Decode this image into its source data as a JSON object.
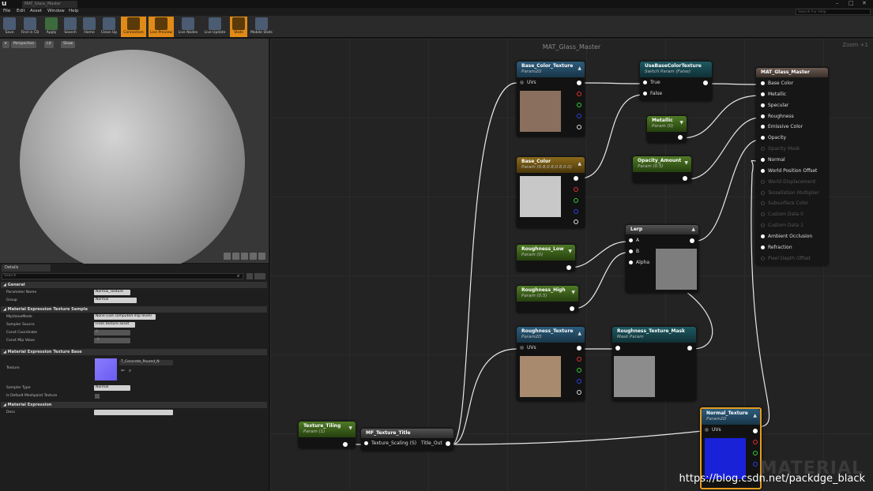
{
  "window": {
    "tab": "MAT_Glass_Master",
    "help_search_placeholder": "Search For Help",
    "controls": [
      "–",
      "□",
      "✕"
    ]
  },
  "menu": [
    "File",
    "Edit",
    "Asset",
    "Window",
    "Help"
  ],
  "toolbar": [
    {
      "label": "Save",
      "icon": "save-icon",
      "active": false
    },
    {
      "label": "Find in CB",
      "icon": "search-icon",
      "active": false
    },
    {
      "label": "Apply",
      "icon": "check-icon",
      "active": false
    },
    {
      "label": "Search",
      "icon": "binoculars-icon",
      "active": false
    },
    {
      "label": "Home",
      "icon": "home-icon",
      "active": false
    },
    {
      "label": "Clean Up",
      "icon": "broom-icon",
      "active": false
    },
    {
      "label": "Connectors",
      "icon": "connectors-icon",
      "active": true
    },
    {
      "label": "Live Preview",
      "icon": "live-preview-icon",
      "active": true
    },
    {
      "label": "Live Nodes",
      "icon": "live-nodes-icon",
      "active": false
    },
    {
      "label": "Live Update",
      "icon": "live-update-icon",
      "active": false
    },
    {
      "label": "Stats",
      "icon": "stats-icon",
      "active": true
    },
    {
      "label": "Mobile Stats",
      "icon": "mobile-stats-icon",
      "active": false
    }
  ],
  "viewport": {
    "buttons": [
      "Perspective",
      "Lit",
      "Show"
    ]
  },
  "details": {
    "tab": "Details",
    "search_placeholder": "Search",
    "sections": {
      "general": "General",
      "mip": "Material Expression Texture Sample",
      "tex_base": "Material Expression Texture Base",
      "expr": "Material Expression"
    },
    "rows": {
      "param_name": {
        "label": "Parameter Name",
        "value": "Normal_Texture"
      },
      "group": {
        "label": "Group",
        "value": "Normal"
      },
      "mip_mode": {
        "label": "MipValueMode",
        "value": "None (use computed mip level)"
      },
      "sampler_source": {
        "label": "Sampler Source",
        "value": "From texture asset"
      },
      "const_coord": {
        "label": "Const Coordinate",
        "value": "0"
      },
      "const_mip": {
        "label": "Const Mip Value",
        "value": "-1"
      },
      "texture": {
        "label": "Texture",
        "value": "T_Concrete_Poured_N"
      },
      "sampler_type": {
        "label": "Sampler Type",
        "value": "Normal"
      },
      "default_mesh": {
        "label": "Is Default Meshpaint Texture"
      },
      "desc": {
        "label": "Desc",
        "value": ""
      }
    }
  },
  "graph": {
    "title": "MAT_Glass_Master",
    "zoom": "Zoom +1",
    "watermark": "MATERIAL",
    "url": "https://blog.csdn.net/packdge_black",
    "nodes": {
      "base_color_texture": {
        "title": "Base_Color_Texture",
        "sub": "Param2D",
        "pin": "UVs"
      },
      "use_base_color": {
        "title": "UseBaseColorTexture",
        "sub": "Switch Param (False)",
        "pin_true": "True",
        "pin_false": "False"
      },
      "metallic": {
        "title": "Metallic",
        "sub": "Param (0)"
      },
      "base_color": {
        "title": "Base_Color",
        "sub": "Param (0.8,0.8,0.8,0.0)"
      },
      "opacity_amount": {
        "title": "Opacity_Amount",
        "sub": "Param (0.5)"
      },
      "lerp": {
        "title": "Lerp",
        "pin_a": "A",
        "pin_b": "B",
        "pin_alpha": "Alpha"
      },
      "roughness_low": {
        "title": "Roughness_Low",
        "sub": "Param (0)"
      },
      "roughness_high": {
        "title": "Roughness_High",
        "sub": "Param (0.5)"
      },
      "roughness_texture": {
        "title": "Roughness_Texture",
        "sub": "Param2D",
        "pin": "UVs"
      },
      "roughness_mask": {
        "title": "Roughness_Texture_Mask",
        "sub": "Mask Param"
      },
      "texture_tiling": {
        "title": "Texture_Tiling",
        "sub": "Param (1)"
      },
      "mf_texture_title": {
        "title": "MF_Texture_Title",
        "pin_in": "Texture_Scaling (S)",
        "pin_out": "Title_Out"
      },
      "normal_texture": {
        "title": "Normal_Texture",
        "sub": "Param2D",
        "pin": "UVs"
      },
      "master": {
        "title": "MAT_Glass_Master",
        "pins": [
          {
            "label": "Base Color",
            "enabled": true
          },
          {
            "label": "Metallic",
            "enabled": true
          },
          {
            "label": "Specular",
            "enabled": true
          },
          {
            "label": "Roughness",
            "enabled": true
          },
          {
            "label": "Emissive Color",
            "enabled": true
          },
          {
            "label": "Opacity",
            "enabled": true
          },
          {
            "label": "Opacity Mask",
            "enabled": false
          },
          {
            "label": "Normal",
            "enabled": true
          },
          {
            "label": "World Position Offset",
            "enabled": true
          },
          {
            "label": "World Displacement",
            "enabled": false
          },
          {
            "label": "Tessellation Multiplier",
            "enabled": false
          },
          {
            "label": "Subsurface Color",
            "enabled": false
          },
          {
            "label": "Custom Data 0",
            "enabled": false
          },
          {
            "label": "Custom Data 1",
            "enabled": false
          },
          {
            "label": "Ambient Occlusion",
            "enabled": true
          },
          {
            "label": "Refraction",
            "enabled": true
          },
          {
            "label": "Pixel Depth Offset",
            "enabled": false
          }
        ]
      }
    }
  }
}
